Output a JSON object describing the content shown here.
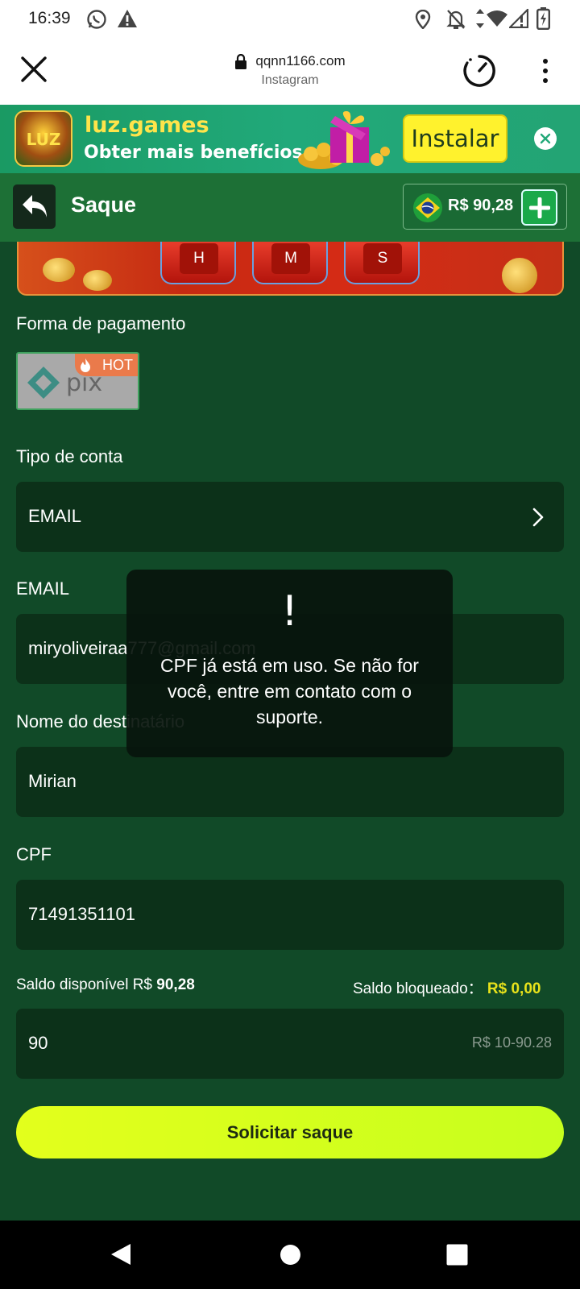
{
  "status_bar": {
    "time": "16:39",
    "icons": [
      "whatsapp-icon",
      "warning-icon",
      "location-icon",
      "bell-off-icon",
      "data-arrows-icon",
      "wifi-icon",
      "signal-icon",
      "battery-charging-icon"
    ]
  },
  "browser": {
    "url": "qqnn1166.com",
    "source": "Instagram",
    "icons": [
      "close-icon",
      "lock-icon",
      "timer-icon",
      "more-vert-icon"
    ]
  },
  "banner": {
    "logo_text": "LUZ",
    "brand": "luz.games",
    "tagline": "Obter mais benefícios",
    "install_label": "Instalar",
    "colors": {
      "background": "#21a97a",
      "brand_text": "#ffe44a",
      "install_bg": "#fff22d"
    }
  },
  "header": {
    "title": "Saque",
    "balance": "R$ 90,28",
    "colors": {
      "background": "#1d7036"
    }
  },
  "countdown": {
    "labels": [
      "H",
      "M",
      "S"
    ]
  },
  "form": {
    "payment_method_label": "Forma de pagamento",
    "payment_method": {
      "badge": "HOT",
      "logo_text": "pix"
    },
    "account_type_label": "Tipo de conta",
    "account_type_value": "EMAIL",
    "email_label": "EMAIL",
    "email_value": "miryoliveiraa777@gmail.com",
    "recipient_label": "Nome do destinatário",
    "recipient_value": "Mirian",
    "cpf_label": "CPF",
    "cpf_value": "71491351101",
    "available_label": "Saldo disponível R$",
    "available_value": "90,28",
    "blocked_label": "Saldo bloqueado：",
    "blocked_value": "R$ 0,00",
    "amount_value": "90",
    "amount_range": "R$ 10-90.28",
    "submit_label": "Solicitar saque",
    "colors": {
      "page_bg": "#114a28",
      "field_bg": "#0c3119",
      "submit_bg": "#d9ff1c",
      "blocked_value": "#e8e21b"
    }
  },
  "toast": {
    "icon": "!",
    "message": "CPF já está em uso. Se não for você, entre em contato com o suporte."
  },
  "nav": {
    "icons": [
      "back-triangle-icon",
      "home-circle-icon",
      "recents-square-icon"
    ]
  }
}
